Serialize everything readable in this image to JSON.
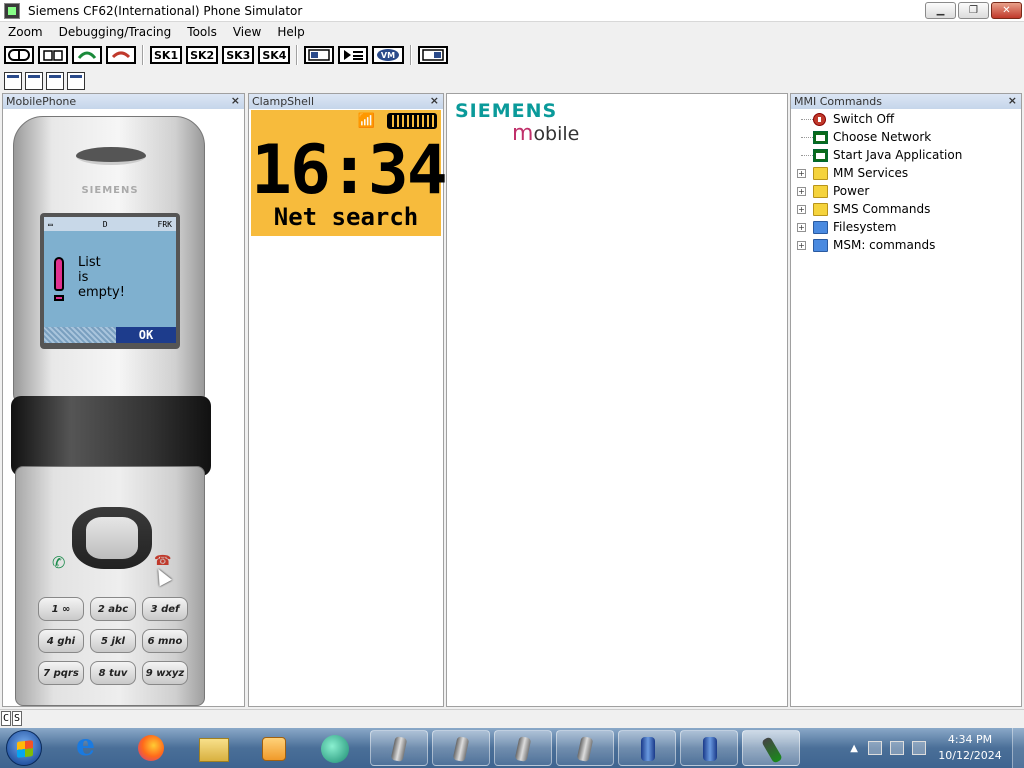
{
  "window": {
    "title": "Siemens CF62(International) Phone Simulator",
    "controls": {
      "minimize": "▁",
      "maximize": "❐",
      "close": "✕"
    }
  },
  "menu": [
    "Zoom",
    "Debugging/Tracing",
    "Tools",
    "View",
    "Help"
  ],
  "toolbar": {
    "sk1": "SK1",
    "sk2": "SK2",
    "sk3": "SK3",
    "sk4": "SK4",
    "vm": "VM"
  },
  "panels": {
    "mobile_phone": {
      "title": "MobilePhone",
      "close": "×"
    },
    "clamp_shell": {
      "title": "ClampShell",
      "close": "×"
    },
    "mmi_commands": {
      "title": "MMI Commands",
      "close": "×"
    }
  },
  "phone": {
    "brand": "SIEMENS",
    "status_left": "D",
    "status_right": "FRK",
    "message": [
      "List",
      "is",
      "empty!"
    ],
    "softkey": "OK",
    "keys": [
      "1 ∞",
      "2 abc",
      "3 def",
      "4 ghi",
      "5 jkl",
      "6 mno",
      "7 pqrs",
      "8 tuv",
      "9 wxyz"
    ]
  },
  "clamp": {
    "time": "16:34",
    "status": "Net search",
    "signal_icon": "📶"
  },
  "logo": {
    "line1": "SIEMENS",
    "mobile_m": "m",
    "mobile_rest": "obile"
  },
  "mmi": {
    "items": [
      {
        "label": "Switch Off",
        "icon": "power-icon",
        "expandable": false
      },
      {
        "label": "Choose Network",
        "icon": "window-icon",
        "expandable": false
      },
      {
        "label": "Start Java Application",
        "icon": "window-icon",
        "expandable": false
      },
      {
        "label": "MM Services",
        "icon": "folder-icon",
        "expandable": true
      },
      {
        "label": "Power",
        "icon": "folder-icon",
        "expandable": true
      },
      {
        "label": "SMS Commands",
        "icon": "folder-icon",
        "expandable": true
      },
      {
        "label": "Filesystem",
        "icon": "folder-blue-icon",
        "expandable": true
      },
      {
        "label": "MSM: commands",
        "icon": "folder-blue-icon",
        "expandable": true
      }
    ]
  },
  "statusbar": {
    "cell1": "C",
    "cell2": "S"
  },
  "taskbar": {
    "clock_time": "4:34 PM",
    "clock_date": "10/12/2024",
    "tray_arrow": "▲"
  },
  "colors": {
    "clamp_bg": "#f7bb3c",
    "phone_screen_bg": "#7fb0cf",
    "siemens_teal": "#0a9a9a",
    "mobile_magenta": "#c0306a"
  }
}
